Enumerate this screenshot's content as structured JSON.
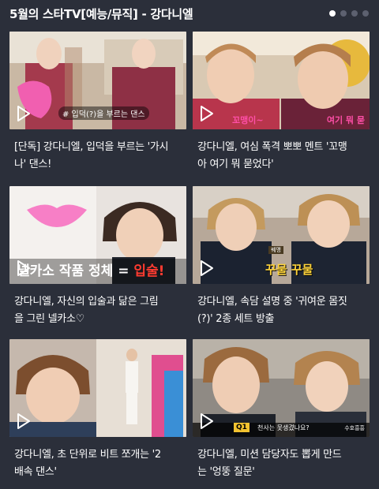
{
  "section": {
    "title": "5월의 스타TV[예능/뮤직] - 강다니엘",
    "page_dots": [
      {
        "active": true
      },
      {
        "active": false
      },
      {
        "active": false
      },
      {
        "active": false
      }
    ]
  },
  "cards": [
    {
      "caption_line1": "[단독] 강다니엘, 입덕을 부르는 '가시",
      "caption_line2": "나' 댄스!",
      "overlay": "# 입덕(?)을 부르는 댄스"
    },
    {
      "caption_line1": "강다니엘, 여심 폭격 뽀뽀 멘트 '꼬맹",
      "caption_line2": "아 여기 뭐 묻었다'",
      "overlay_left": "꼬맹이~",
      "overlay_right": "여기 뭐 묻"
    },
    {
      "caption_line1": "강다니엘, 자신의 입술과 닮은 그림",
      "caption_line2": "을 그린 넬카소♡",
      "overlay_a": "넬카소 작품 정체 = ",
      "overlay_b": "입술!"
    },
    {
      "caption_line1": "강다니엘, 속담 설명 중 '귀여운 몸짓",
      "caption_line2": "(?)' 2종 세트 방출",
      "overlay_tag": "꿰맹",
      "overlay": "꾸물 꾸물"
    },
    {
      "caption_line1": "강다니엘, 초 단위로 비트 쪼개는 '2",
      "caption_line2": "배속 댄스'"
    },
    {
      "caption_line1": "강다니엘, 미션 담당자도 뽑게 만드",
      "caption_line2": "는 '엉뚱 질문'",
      "overlay_q": "Q1",
      "overlay_text": "천사는 못생겼나요?",
      "overlay_right": "수호흥흥"
    }
  ],
  "colors": {
    "background": "#2b2f3a",
    "dot_active": "#ffffff",
    "dot_inactive": "#5d6170"
  }
}
